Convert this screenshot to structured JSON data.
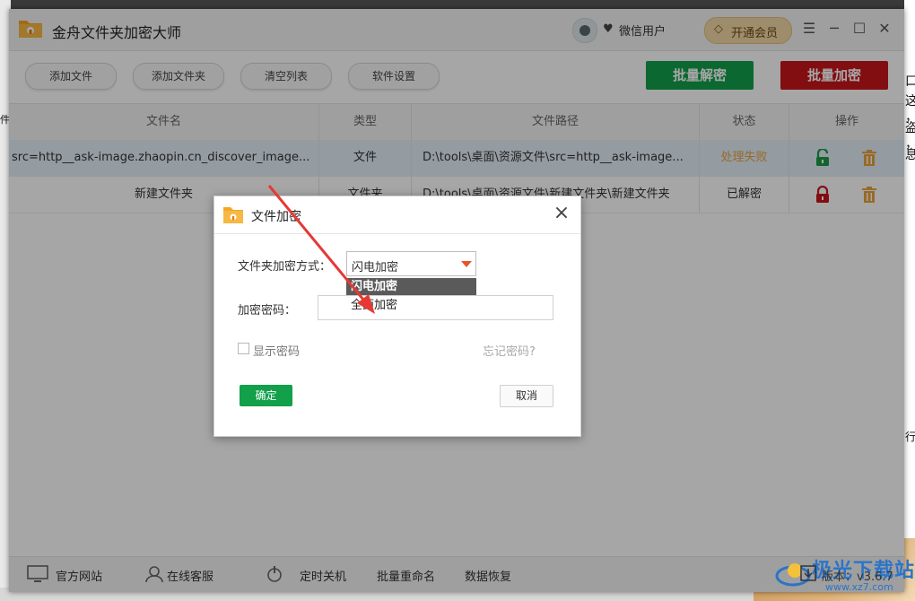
{
  "background": {
    "right_edge_chars": [
      "口",
      "这",
      "，",
      "盗",
      "，",
      "息"
    ],
    "left_edge_chars": [
      "件"
    ],
    "right_mid_chars": [
      "行"
    ]
  },
  "app": {
    "title": "金舟文件夹加密大师",
    "user_name": "微信用户",
    "vip_label": "开通会员",
    "window_controls": [
      "☰",
      "─",
      "☐",
      "✕"
    ]
  },
  "toolbar": {
    "buttons": [
      "添加文件",
      "添加文件夹",
      "清空列表",
      "软件设置"
    ],
    "batch_decrypt": "批量解密",
    "batch_encrypt": "批量加密"
  },
  "table": {
    "columns": [
      "文件名",
      "类型",
      "文件路径",
      "状态",
      "操作"
    ],
    "rows": [
      {
        "name": "src=http__ask-image.zhaopin.cn_discover_image...",
        "type": "文件",
        "path": "D:\\tools\\桌面\\资源文件\\src=http__ask-image...",
        "status": "处理失败"
      },
      {
        "name": "新建文件夹",
        "type": "文件夹",
        "path": "D:\\tools\\桌面\\资源文件\\新建文件夹\\新建文件夹",
        "status": "已解密"
      }
    ]
  },
  "footer": {
    "items": [
      "官方网站",
      "在线客服",
      "定时关机",
      "批量重命名",
      "数据恢复"
    ],
    "version": "版本：v3.6.7"
  },
  "dialog": {
    "title": "文件加密",
    "method_label": "文件夹加密方式：",
    "method_value": "闪电加密",
    "method_options": [
      "闪电加密",
      "全面加密"
    ],
    "password_label": "加密密码：",
    "password_value": "",
    "show_password_label": "显示密码",
    "forgot_label": "忘记密码?",
    "ok_label": "确定",
    "cancel_label": "取消"
  },
  "watermark": {
    "text": "极光下载站",
    "url": "www.xz7.com"
  },
  "colors": {
    "green": "#12a04a",
    "red": "#c8161d",
    "fail": "#e8a33d",
    "arrow": "#e53935"
  }
}
